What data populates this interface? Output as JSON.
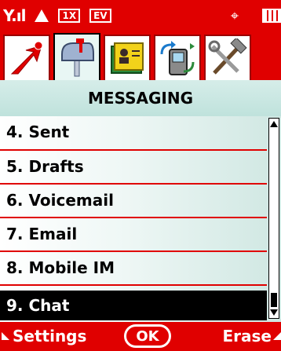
{
  "status_bar": {
    "signal_text": "Y.ıl",
    "network_1": "1X",
    "network_2": "EV",
    "target_symbol": "⌖"
  },
  "tabs": [
    {
      "icon": "arrow-icon"
    },
    {
      "icon": "mailbox-icon",
      "selected": true
    },
    {
      "icon": "contacts-book-icon"
    },
    {
      "icon": "phone-sync-icon"
    },
    {
      "icon": "tools-icon"
    }
  ],
  "menu": {
    "title": "MESSAGING",
    "items": [
      {
        "label": "4. Sent"
      },
      {
        "label": "5. Drafts"
      },
      {
        "label": "6. Voicemail"
      },
      {
        "label": "7. Email"
      },
      {
        "label": "8. Mobile IM"
      },
      {
        "label": "9. Chat",
        "selected": true
      }
    ]
  },
  "softkeys": {
    "left": "Settings",
    "center": "OK",
    "right": "Erase"
  },
  "colors": {
    "bar": "#e00000",
    "selection": "#000000"
  }
}
